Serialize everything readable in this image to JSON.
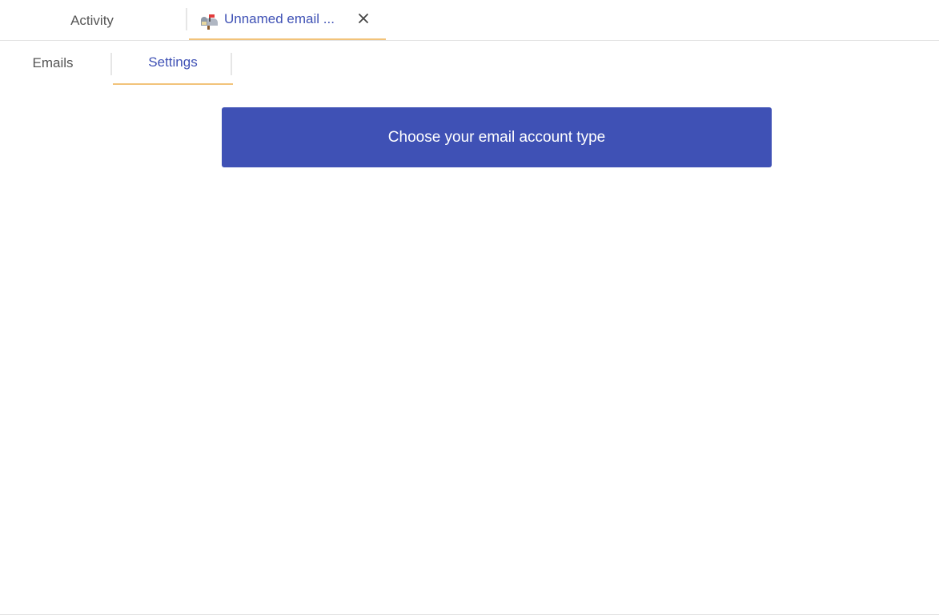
{
  "top_tabs": {
    "activity_label": "Activity",
    "email_tab_label": "Unnamed email ...",
    "email_tab_icon": "mailbox-icon",
    "close_icon": "close-icon"
  },
  "sub_tabs": {
    "emails_label": "Emails",
    "settings_label": "Settings"
  },
  "main": {
    "choose_button_label": "Choose your email account type"
  },
  "colors": {
    "accent": "#3f51b5",
    "active_underline": "#f2c37a",
    "inactive_text": "#555555",
    "divider": "#e6e6e6"
  }
}
